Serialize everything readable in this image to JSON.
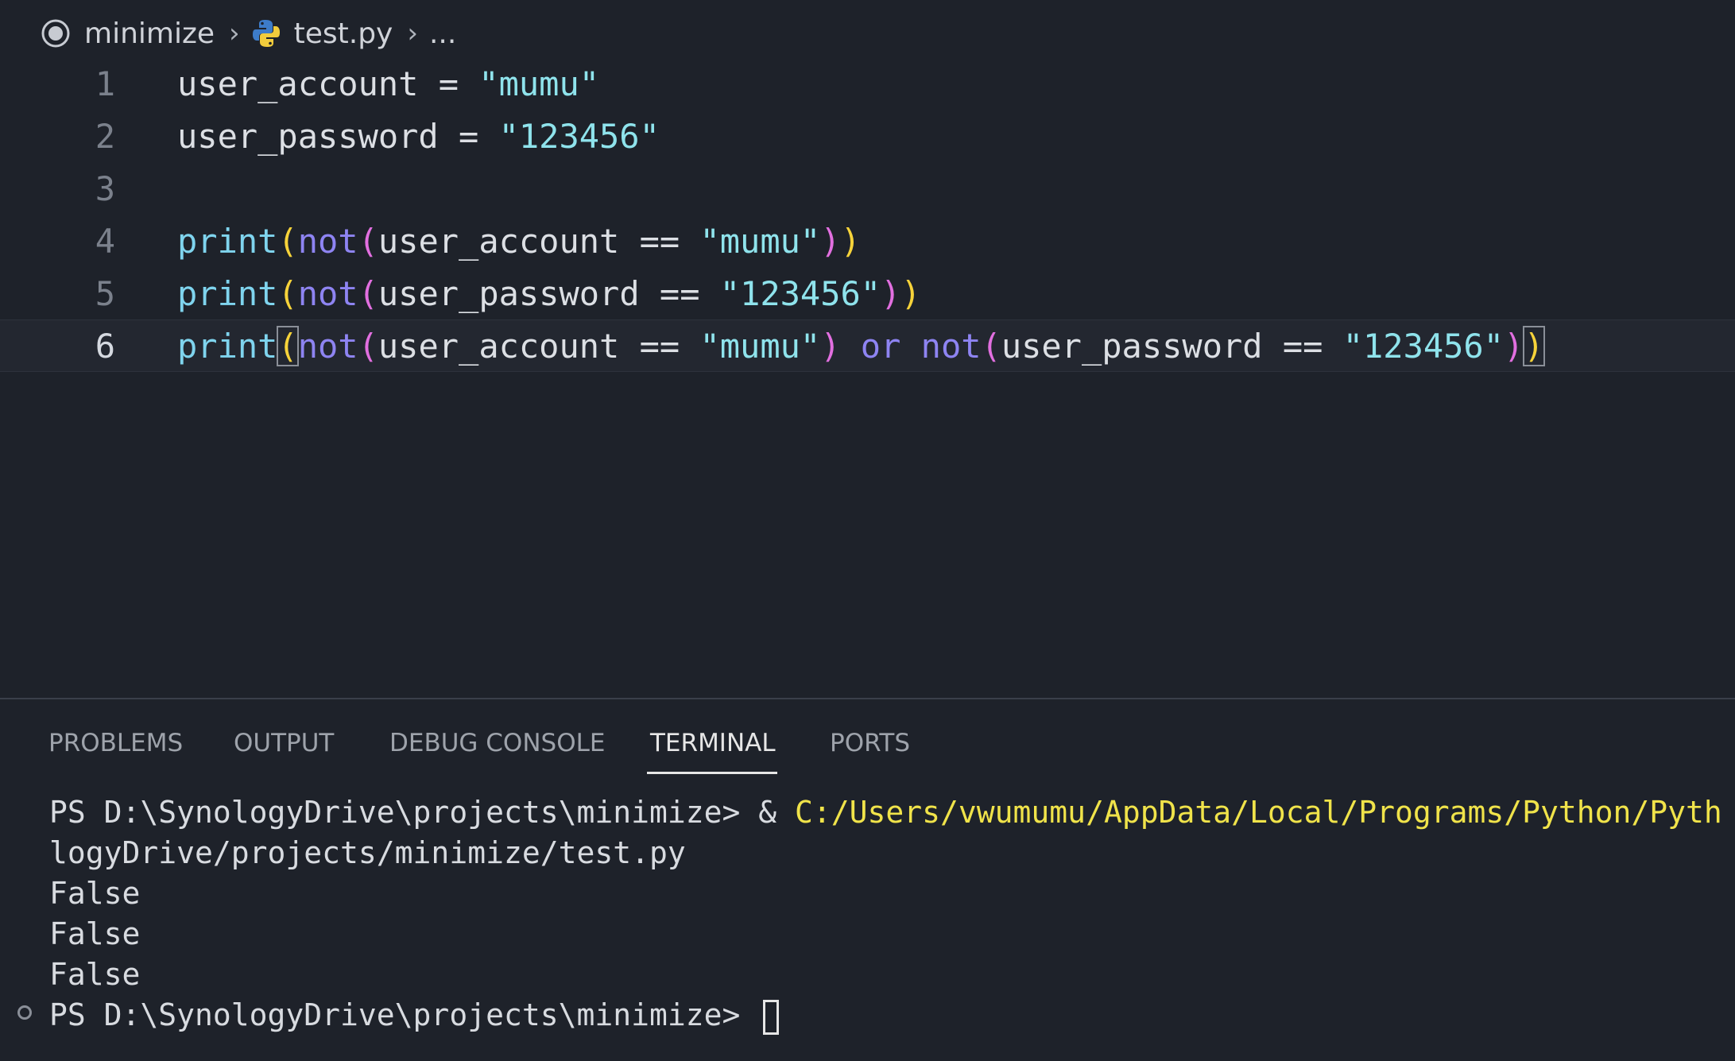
{
  "breadcrumb": {
    "folder": "minimize",
    "file": "test.py",
    "more": "..."
  },
  "editor": {
    "lines": [
      {
        "number": "1"
      },
      {
        "number": "2"
      },
      {
        "number": "3"
      },
      {
        "number": "4"
      },
      {
        "number": "5"
      },
      {
        "number": "6"
      }
    ],
    "current_line": 6
  },
  "panel": {
    "tabs": [
      "PROBLEMS",
      "OUTPUT",
      "DEBUG CONSOLE",
      "TERMINAL",
      "PORTS"
    ],
    "active_tab": "TERMINAL"
  },
  "terminal": {
    "prompt": "PS D:\\SynologyDrive\\projects\\minimize> ",
    "command_prefix": "& ",
    "command_path": "C:/Users/vwumumu/AppData/Local/Programs/Python/Pyth",
    "wrap_line": "logyDrive/projects/minimize/test.py",
    "outputs": [
      "False",
      "False",
      "False"
    ],
    "final_prompt": "PS D:\\SynologyDrive\\projects\\minimize> "
  },
  "colors": {
    "background": "#1e222a",
    "string": "#8fe3ec",
    "keyword": "#8e84f2",
    "bracket_level1": "#f7d33a",
    "bracket_level2": "#e26fe0",
    "terminal_path": "#f0e34a"
  }
}
